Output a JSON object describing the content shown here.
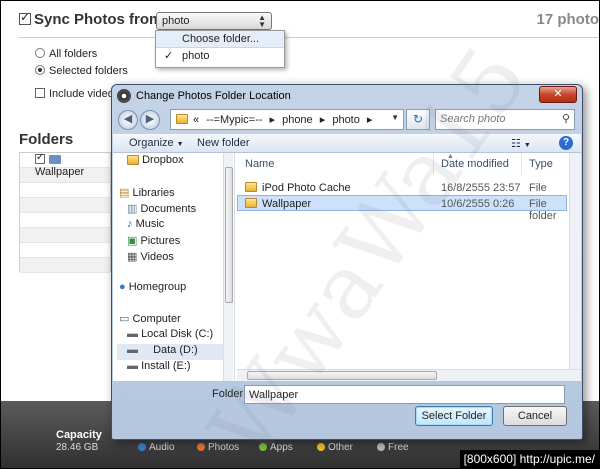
{
  "sync": {
    "title": "Sync Photos from",
    "selected_source": "photo",
    "count": "17 photo",
    "options": [
      "All folders",
      "Selected folders"
    ],
    "include_videos": "Include videos"
  },
  "dropdown": {
    "items": [
      {
        "label": "Choose folder..."
      },
      {
        "label": "photo",
        "checked": "✓"
      }
    ]
  },
  "folders": {
    "title": "Folders",
    "items": [
      "Wallpaper"
    ]
  },
  "bottom": {
    "capacity_label": "Capacity",
    "capacity_value": "28.46 GB",
    "legend": [
      "Audio",
      "Photos",
      "Apps",
      "Other",
      "Free"
    ],
    "legend_colors": [
      "#3d7fd6",
      "#e7743a",
      "#7bc043",
      "#f0c02a",
      "#bbbbbb"
    ]
  },
  "footer": "[800x600] http://upic.me/",
  "dialog": {
    "title": "Change Photos Folder Location",
    "close": "✕",
    "breadcrumb": [
      "«",
      "--=Mypic=--",
      "phone",
      "photo"
    ],
    "search_placeholder": "Search photo",
    "toolbar": {
      "organize": "Organize",
      "new_folder": "New folder",
      "help": "?"
    },
    "nav": [
      {
        "label": "Dropbox",
        "icon": "dropbox-folder-icon"
      },
      {
        "label": "Libraries",
        "icon": "libraries-icon"
      },
      {
        "label": "Documents",
        "icon": "documents-icon"
      },
      {
        "label": "Music",
        "icon": "music-icon"
      },
      {
        "label": "Pictures",
        "icon": "pictures-icon"
      },
      {
        "label": "Videos",
        "icon": "videos-icon"
      },
      {
        "label": "Homegroup",
        "icon": "homegroup-icon"
      },
      {
        "label": "Computer",
        "icon": "computer-icon"
      },
      {
        "label": "Local Disk (C:)",
        "icon": "drive-icon"
      },
      {
        "label": "Data (D:)",
        "icon": "drive-icon"
      },
      {
        "label": "Install (E:)",
        "icon": "drive-icon"
      }
    ],
    "columns": [
      "Name",
      "Date modified",
      "Type"
    ],
    "files": [
      {
        "name": "iPod Photo Cache",
        "date": "16/8/2555 23:57",
        "type": "File folder"
      },
      {
        "name": "Wallpaper",
        "date": "10/6/2555 0:26",
        "type": "File folder"
      }
    ],
    "folder_label": "Folder:",
    "folder_value": "Wallpaper",
    "select_button": "Select Folder",
    "cancel_button": "Cancel"
  },
  "watermark": "WwaWa15"
}
